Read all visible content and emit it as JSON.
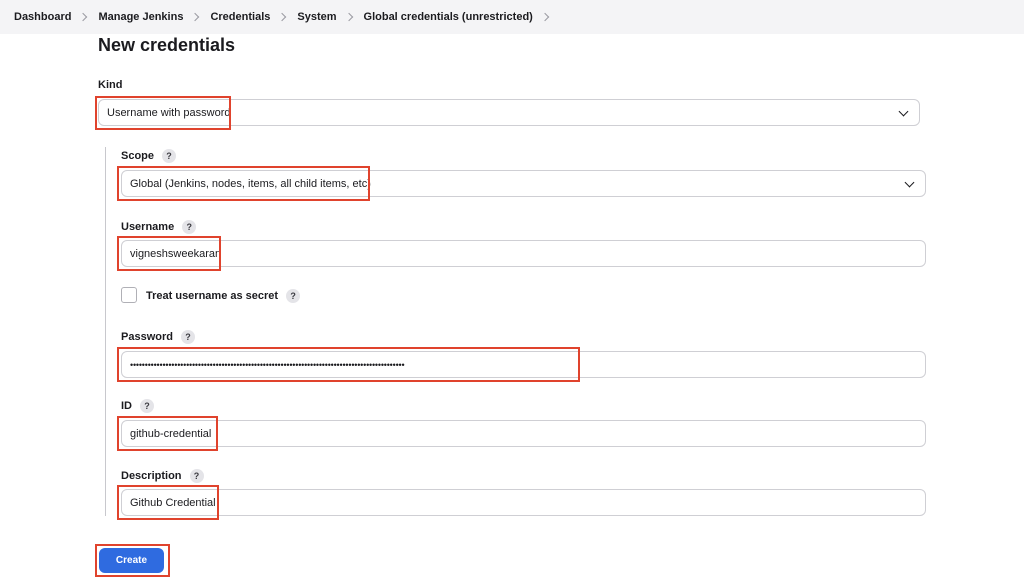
{
  "breadcrumb": [
    "Dashboard",
    "Manage Jenkins",
    "Credentials",
    "System",
    "Global credentials (unrestricted)"
  ],
  "page_title": "New credentials",
  "form": {
    "kind": {
      "label": "Kind",
      "value": "Username with password"
    },
    "scope": {
      "label": "Scope",
      "help": "?",
      "value": "Global (Jenkins, nodes, items, all child items, etc)"
    },
    "username": {
      "label": "Username",
      "help": "?",
      "value": "vigneshsweekaran"
    },
    "treat_secret": {
      "label": "Treat username as secret",
      "help": "?",
      "checked": false
    },
    "password": {
      "label": "Password",
      "help": "?",
      "value": "•••••••••••••••••••••••••••••••••••••••••••••••••••••••••••••••••••••••••••••••••••••••••••••"
    },
    "id": {
      "label": "ID",
      "help": "?",
      "value": "github-credential"
    },
    "description": {
      "label": "Description",
      "help": "?",
      "value": "Github Credential"
    }
  },
  "create_button": "Create",
  "colors": {
    "accent": "#2f6be0",
    "highlight": "#e0432d"
  }
}
